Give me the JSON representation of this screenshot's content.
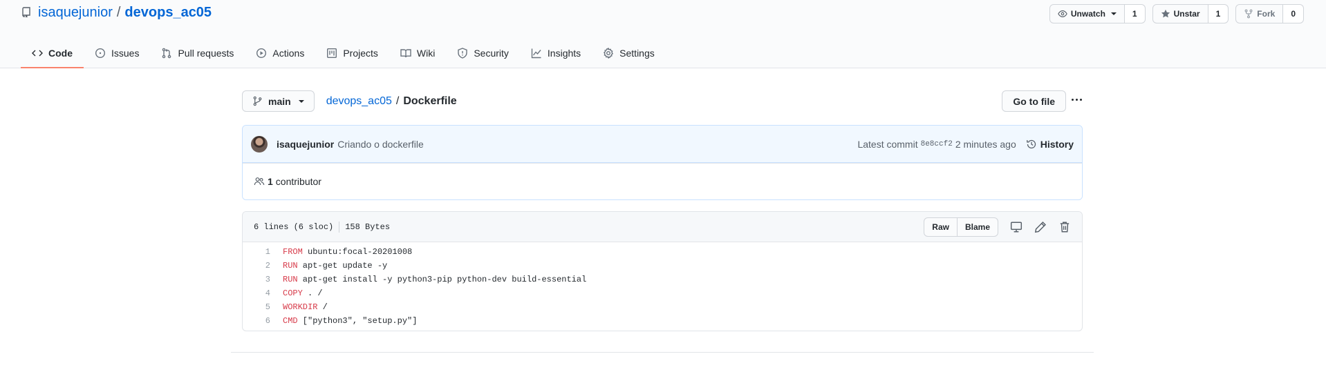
{
  "repo": {
    "owner": "isaquejunior",
    "separator": "/",
    "name": "devops_ac05"
  },
  "header_buttons": {
    "watch": {
      "label": "Unwatch",
      "count": "1"
    },
    "star": {
      "label": "Unstar",
      "count": "1"
    },
    "fork": {
      "label": "Fork",
      "count": "0"
    }
  },
  "tabs": [
    {
      "label": "Code",
      "icon": "code-icon"
    },
    {
      "label": "Issues",
      "icon": "issue-icon"
    },
    {
      "label": "Pull requests",
      "icon": "pull-request-icon"
    },
    {
      "label": "Actions",
      "icon": "play-icon"
    },
    {
      "label": "Projects",
      "icon": "project-icon"
    },
    {
      "label": "Wiki",
      "icon": "book-icon"
    },
    {
      "label": "Security",
      "icon": "shield-icon"
    },
    {
      "label": "Insights",
      "icon": "graph-icon"
    },
    {
      "label": "Settings",
      "icon": "gear-icon"
    }
  ],
  "file_nav": {
    "branch": "main",
    "breadcrumb_repo": "devops_ac05",
    "breadcrumb_sep": "/",
    "file": "Dockerfile",
    "goto_label": "Go to file"
  },
  "commit": {
    "author": "isaquejunior",
    "message": "Criando o dockerfile",
    "latest_label": "Latest commit",
    "sha": "8e8ccf2",
    "time": "2 minutes ago",
    "history_label": "History"
  },
  "contributors": {
    "count": "1",
    "label": "contributor"
  },
  "file_info": {
    "lines": "6 lines (6 sloc)",
    "size": "158 Bytes",
    "raw_label": "Raw",
    "blame_label": "Blame"
  },
  "code_lines": [
    {
      "num": "1",
      "kw": "FROM",
      "rest": " ubuntu:focal-20201008"
    },
    {
      "num": "2",
      "kw": "RUN",
      "rest": " apt-get update -y"
    },
    {
      "num": "3",
      "kw": "RUN",
      "rest": " apt-get install -y python3-pip python-dev build-essential"
    },
    {
      "num": "4",
      "kw": "COPY",
      "rest": " . /"
    },
    {
      "num": "5",
      "kw": "WORKDIR",
      "rest": " /"
    },
    {
      "num": "6",
      "kw": "CMD",
      "rest": " [\"python3\", \"setup.py\"]"
    }
  ],
  "colors": {
    "link": "#0366d6",
    "keyword": "#d73a49",
    "tab_underline": "#f9826c"
  }
}
